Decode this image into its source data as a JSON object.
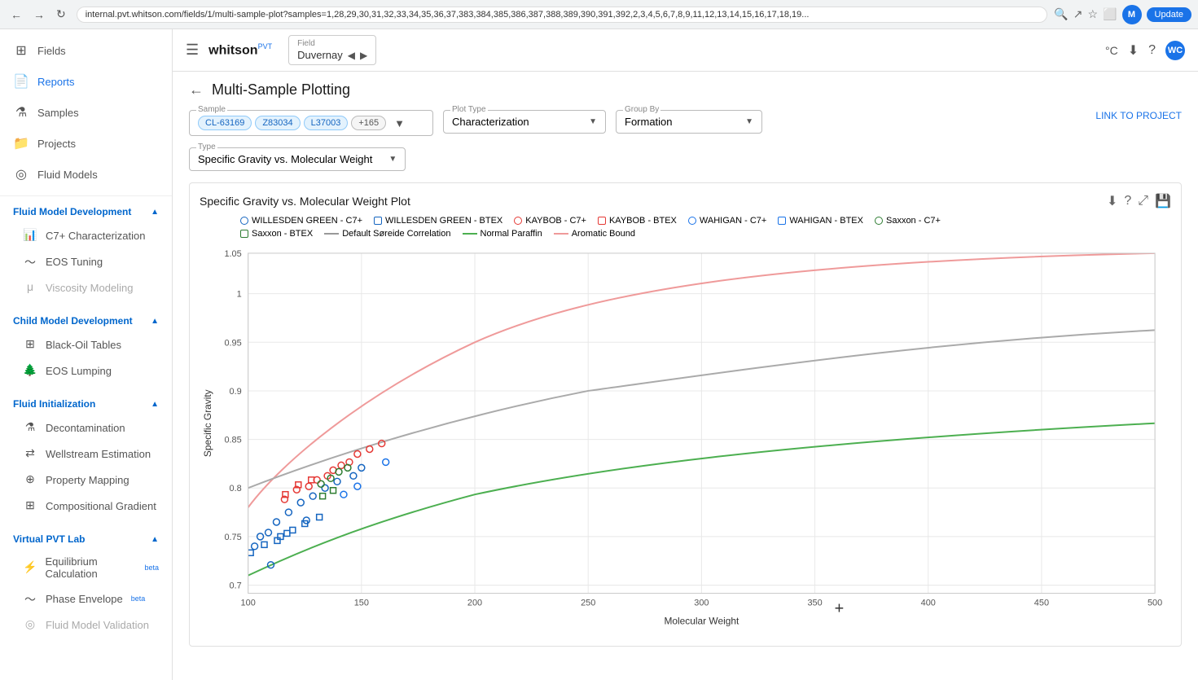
{
  "browser": {
    "url": "internal.pvt.whitson.com/fields/1/multi-sample-plot?samples=1,28,29,30,31,32,33,34,35,36,37,383,384,385,386,387,388,389,390,391,392,2,3,4,5,6,7,8,9,11,12,13,14,15,16,17,18,19...",
    "update_label": "Update",
    "user_initial": "WC"
  },
  "sidebar": {
    "nav_items": [
      {
        "label": "Fields",
        "icon": "⊞"
      },
      {
        "label": "Reports",
        "icon": "📄"
      },
      {
        "label": "Samples",
        "icon": "⚗"
      },
      {
        "label": "Projects",
        "icon": "📁"
      },
      {
        "label": "Fluid Models",
        "icon": "◎"
      }
    ],
    "sections": [
      {
        "label": "Fluid Model Development",
        "items": [
          {
            "label": "C7+ Characterization",
            "icon": "📊",
            "disabled": false
          },
          {
            "label": "EOS Tuning",
            "icon": "〜",
            "disabled": false
          },
          {
            "label": "Viscosity Modeling",
            "icon": "μ",
            "disabled": true
          }
        ]
      },
      {
        "label": "Child Model Development",
        "items": [
          {
            "label": "Black-Oil Tables",
            "icon": "⊞",
            "disabled": false
          },
          {
            "label": "EOS Lumping",
            "icon": "🌲",
            "disabled": false
          }
        ]
      },
      {
        "label": "Fluid Initialization",
        "items": [
          {
            "label": "Decontamination",
            "icon": "⚗",
            "disabled": false
          },
          {
            "label": "Wellstream Estimation",
            "icon": "⇄",
            "disabled": false
          },
          {
            "label": "Property Mapping",
            "icon": "⊕",
            "disabled": false
          },
          {
            "label": "Compositional Gradient",
            "icon": "⊞",
            "disabled": false
          }
        ]
      },
      {
        "label": "Virtual PVT Lab",
        "items": [
          {
            "label": "Equilibrium Calculation",
            "badge": "beta",
            "icon": "⚡",
            "disabled": false
          },
          {
            "label": "Phase Envelope",
            "badge": "beta",
            "icon": "〜",
            "disabled": false
          },
          {
            "label": "Fluid Model Validation",
            "icon": "◎",
            "disabled": true
          }
        ]
      }
    ]
  },
  "topbar": {
    "logo": "whitson",
    "logo_sup": "PVT",
    "field_label": "Field",
    "field_value": "Duvernay"
  },
  "page": {
    "title": "Multi-Sample Plotting",
    "back_label": "←",
    "link_to_project": "LINK TO PROJECT"
  },
  "controls": {
    "sample_label": "Sample",
    "chips": [
      "CL-63169",
      "Z83034",
      "L37003"
    ],
    "extra_chips": "+165",
    "plot_type_label": "Plot Type",
    "plot_type_value": "Characterization",
    "group_by_label": "Group By",
    "group_by_value": "Formation",
    "type_label": "Type",
    "type_value": "Specific Gravity vs. Molecular Weight"
  },
  "plot": {
    "title": "Specific Gravity vs. Molecular Weight Plot",
    "legend": [
      {
        "label": "WILLESDEN GREEN - C7+",
        "color": "#1565c0",
        "shape": "circle"
      },
      {
        "label": "WILLESDEN GREEN - BTEX",
        "color": "#1565c0",
        "shape": "square"
      },
      {
        "label": "KAYBOB - C7+",
        "color": "#e53935",
        "shape": "circle"
      },
      {
        "label": "KAYBOB - BTEX",
        "color": "#e53935",
        "shape": "square"
      },
      {
        "label": "WAHIGAN - C7+",
        "color": "#1a73e8",
        "shape": "circle"
      },
      {
        "label": "WAHIGAN - BTEX",
        "color": "#1a73e8",
        "shape": "square"
      },
      {
        "label": "Saxxon - C7+",
        "color": "#2e7d32",
        "shape": "circle"
      },
      {
        "label": "Saxxon - BTEX",
        "color": "#2e7d32",
        "shape": "square"
      },
      {
        "label": "Default Søreide Correlation",
        "color": "#999",
        "shape": "line"
      },
      {
        "label": "Normal Paraffin",
        "color": "#4caf50",
        "shape": "line"
      },
      {
        "label": "Aromatic Bound",
        "color": "#ef9a9a",
        "shape": "line"
      }
    ],
    "y_axis_label": "Specific Gravity",
    "x_axis_label": "Molecular Weight",
    "x_min": 100,
    "x_max": 500,
    "y_min": 0.7,
    "y_max": 1.05,
    "x_ticks": [
      100,
      150,
      200,
      250,
      300,
      350,
      400,
      450,
      500
    ],
    "y_ticks": [
      0.7,
      0.75,
      0.8,
      0.85,
      0.9,
      0.95,
      1.0,
      1.05
    ]
  }
}
